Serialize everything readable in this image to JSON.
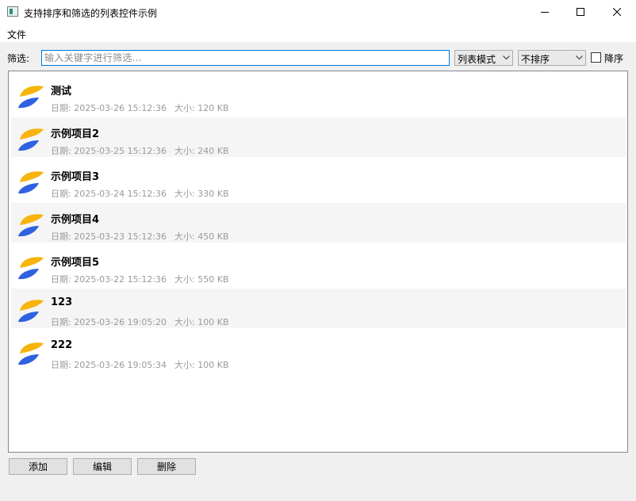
{
  "window": {
    "title": "支持排序和筛选的列表控件示例"
  },
  "menubar": {
    "file_label": "文件"
  },
  "toolbar": {
    "filter_label": "筛选:",
    "filter_placeholder": "输入关键字进行筛选...",
    "filter_value": "",
    "view_mode": "列表模式",
    "sort_mode": "不排序",
    "descending_label": "降序",
    "descending_checked": false
  },
  "list": {
    "date_prefix": "日期:",
    "size_prefix": "大小:",
    "items": [
      {
        "name": "测试",
        "date": "2025-03-26 15:12:36",
        "size": "120 KB"
      },
      {
        "name": "示例项目2",
        "date": "2025-03-25 15:12:36",
        "size": "240 KB"
      },
      {
        "name": "示例项目3",
        "date": "2025-03-24 15:12:36",
        "size": "330 KB"
      },
      {
        "name": "示例项目4",
        "date": "2025-03-23 15:12:36",
        "size": "450 KB"
      },
      {
        "name": "示例项目5",
        "date": "2025-03-22 15:12:36",
        "size": "550 KB"
      },
      {
        "name": "123",
        "date": "2025-03-26 19:05:20",
        "size": "100 KB"
      },
      {
        "name": "222",
        "date": "2025-03-26 19:05:34",
        "size": "100 KB"
      }
    ]
  },
  "buttons": {
    "add_label": "添加",
    "edit_label": "编辑",
    "delete_label": "删除"
  },
  "colors": {
    "icon_top": "#f6b40c",
    "icon_bottom": "#2f62e0",
    "focus_border": "#0078d7"
  }
}
